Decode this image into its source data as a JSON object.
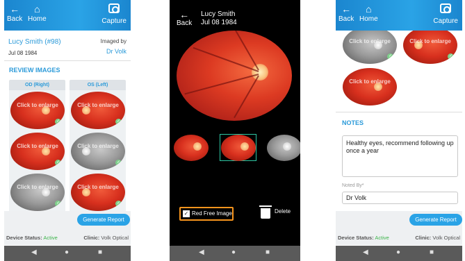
{
  "panel1": {
    "header": {
      "back_label": "Back",
      "home_label": "Home",
      "capture_label": "Capture"
    },
    "patient": {
      "name": "Lucy Smith (#98)",
      "dob": "Jul 08 1984",
      "imaged_by_label": "Imaged by",
      "doctor": "Dr Volk"
    },
    "section_title": "REVIEW IMAGES",
    "columns": [
      "OD (Right)",
      "OS (Left)"
    ],
    "enlarge_text": "Click to enlarge",
    "generate_button": "Generate Report",
    "status": {
      "device_label": "Device Status:",
      "device_value": "Active",
      "clinic_label": "Clinic:",
      "clinic_value": "Volk Optical"
    }
  },
  "panel2": {
    "header": {
      "back_label": "Back",
      "patient_name": "Lucy Smith",
      "dob": "Jul 08 1984"
    },
    "red_free_label": "Red Free Image",
    "red_free_checked": true,
    "delete_label": "Delete"
  },
  "panel3": {
    "header": {
      "back_label": "Back",
      "home_label": "Home",
      "capture_label": "Capture"
    },
    "enlarge_text": "Click to enlarge",
    "notes_title": "NOTES",
    "notes_text": "Healthy eyes, recommend following up once a year",
    "noted_by_label": "Noted By*",
    "noted_by_value": "Dr Volk",
    "generate_button": "Generate Report",
    "status": {
      "device_label": "Device Status:",
      "device_value": "Active",
      "clinic_label": "Clinic:",
      "clinic_value": "Volk Optical"
    }
  },
  "navbar_icons": [
    "back-triangle-icon",
    "home-circle-icon",
    "recents-square-icon"
  ],
  "colors": {
    "accent": "#2aa3e6",
    "highlight": "#f7941d",
    "active": "#3cb44b"
  }
}
